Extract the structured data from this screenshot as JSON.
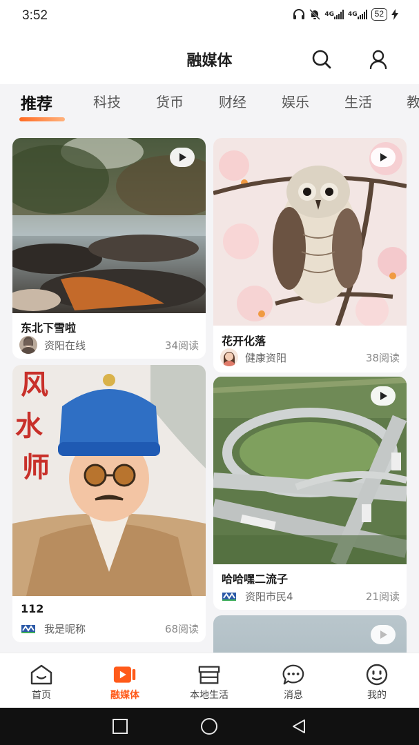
{
  "status_bar": {
    "time": "3:52",
    "net1": "4G",
    "net2": "4G",
    "battery": "52",
    "icons": [
      "headphones-icon",
      "bell-muted-icon",
      "signal-icon",
      "signal-icon",
      "battery-icon",
      "charging-icon"
    ]
  },
  "header": {
    "title": "融媒体",
    "icons": [
      "search-icon",
      "user-icon"
    ]
  },
  "tabs": [
    "推荐",
    "科技",
    "货币",
    "财经",
    "娱乐",
    "生活",
    "教"
  ],
  "active_tab": "推荐",
  "feed": {
    "cards": [
      {
        "title": "东北下雪啦",
        "author": "资阳在线",
        "reads": "34阅读",
        "video": true
      },
      {
        "title": "花开化落",
        "author": "健康资阳",
        "reads": "38阅读",
        "video": true
      },
      {
        "title": "112",
        "author": "我是昵称",
        "reads": "68阅读",
        "video": false,
        "image_text": [
          "风",
          "水",
          "师"
        ]
      },
      {
        "title": "哈哈嘿二流子",
        "author": "资阳市民4",
        "reads": "21阅读",
        "video": true
      },
      {
        "video": true
      }
    ]
  },
  "bottom_nav": {
    "items": [
      {
        "label": "首页",
        "icon": "home-icon"
      },
      {
        "label": "融媒体",
        "icon": "video-play-icon",
        "active": true
      },
      {
        "label": "本地生活",
        "icon": "store-icon"
      },
      {
        "label": "消息",
        "icon": "chat-bubble-icon"
      },
      {
        "label": "我的",
        "icon": "smiley-icon"
      }
    ]
  },
  "colors": {
    "accent": "#ff5a1a",
    "background": "#f4f4f6",
    "card": "#ffffff",
    "system_nav": "#111111"
  }
}
